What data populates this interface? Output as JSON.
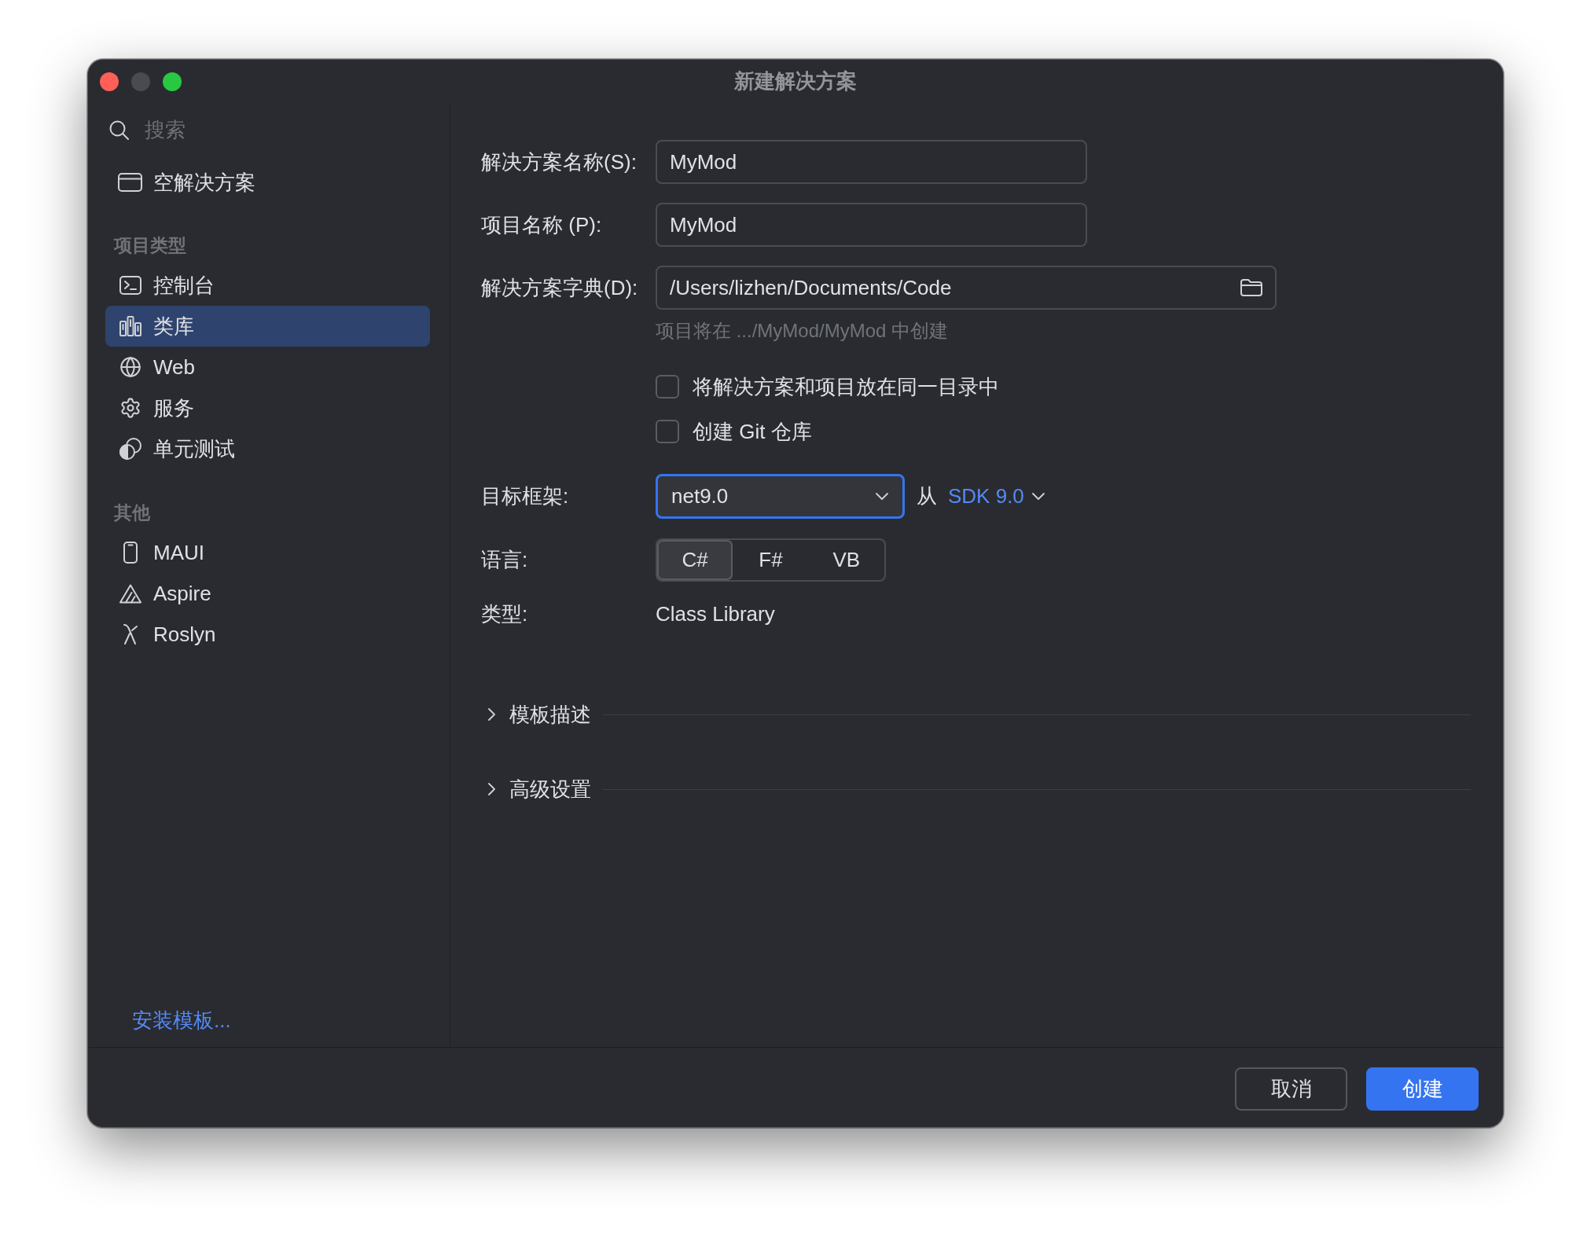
{
  "window": {
    "title": "新建解决方案"
  },
  "sidebar": {
    "search": {
      "placeholder": "搜索"
    },
    "top_items": [
      {
        "label": "空解决方案",
        "selected": false
      }
    ],
    "sections": [
      {
        "title": "项目类型",
        "items": [
          {
            "label": "控制台",
            "selected": false
          },
          {
            "label": "类库",
            "selected": true
          },
          {
            "label": "Web",
            "selected": false
          },
          {
            "label": "服务",
            "selected": false
          },
          {
            "label": "单元测试",
            "selected": false
          }
        ]
      },
      {
        "title": "其他",
        "items": [
          {
            "label": "MAUI",
            "selected": false
          },
          {
            "label": "Aspire",
            "selected": false
          },
          {
            "label": "Roslyn",
            "selected": false
          }
        ]
      }
    ],
    "install_link": "安装模板..."
  },
  "form": {
    "fields": [
      {
        "kind": "text",
        "label": "解决方案名称(S):",
        "value": "MyMod"
      },
      {
        "kind": "text",
        "label": "项目名称 (P):",
        "value": "MyMod"
      },
      {
        "kind": "path",
        "label": "解决方案字典(D):",
        "value": "/Users/lizhen/Documents/Code"
      }
    ],
    "location_hint": "项目将在 .../MyMod/MyMod 中创建",
    "checkboxes": [
      {
        "label": "将解决方案和项目放在同一目录中",
        "checked": false
      },
      {
        "label": "创建 Git 仓库",
        "checked": false
      }
    ],
    "target_framework": {
      "label": "目标框架:",
      "value": "net9.0",
      "focused": true,
      "source_label": "从",
      "sdk": "SDK 9.0"
    },
    "language": {
      "label": "语言:",
      "options": [
        {
          "label": "C#",
          "selected": true
        },
        {
          "label": "F#",
          "selected": false
        },
        {
          "label": "VB",
          "selected": false
        }
      ]
    },
    "project_type": {
      "label": "类型:",
      "value": "Class Library"
    },
    "sections": [
      {
        "label": "模板描述",
        "expanded": false
      },
      {
        "label": "高级设置",
        "expanded": false
      }
    ]
  },
  "buttons": [
    {
      "kind": "secondary",
      "label": "取消"
    },
    {
      "kind": "primary",
      "label": "创建"
    }
  ]
}
